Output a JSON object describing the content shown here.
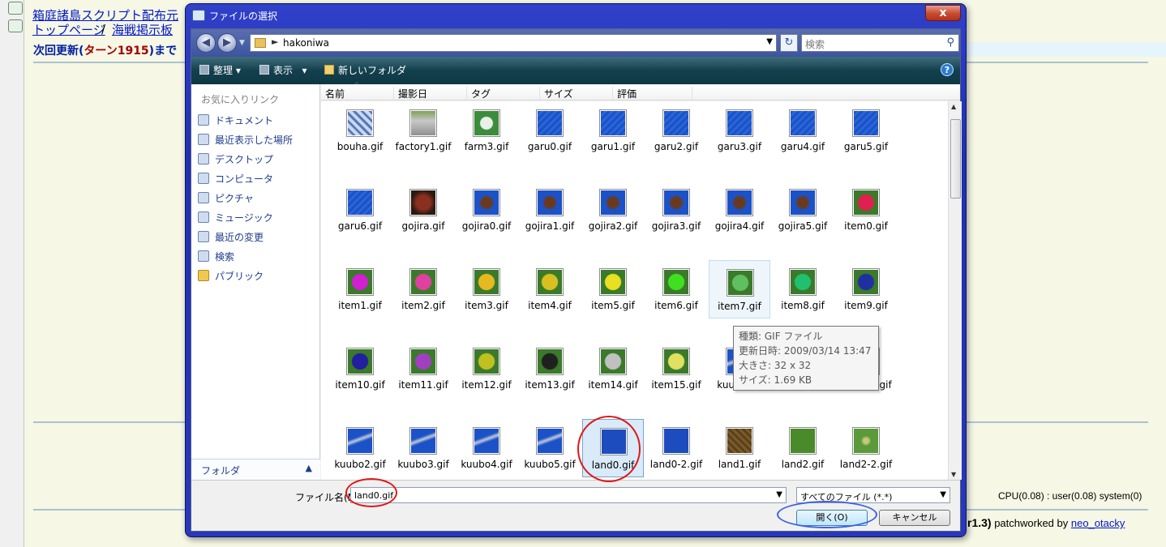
{
  "background": {
    "link1": "箱庭諸島スクリプト配布元",
    "link2": "トップページ",
    "link3": "海戦掲示板",
    "sep": "/",
    "notice": "次回更新(",
    "notice_turn": "ターン1915",
    "notice_tail": ")まで",
    "cpu": "CPU(0.08) : user(0.08) system(0)",
    "version": "r1.3)",
    "patch": " patchworked by ",
    "author": "neo_otacky"
  },
  "dialog": {
    "title": "ファイルの選択",
    "close": "x",
    "address": "hakoniwa",
    "search_placeholder": "検索",
    "toolbar": {
      "organize": "整理",
      "view": "表示",
      "new_folder": "新しいフォルダ",
      "help": "?"
    },
    "nav": {
      "favorites_title": "お気に入りリンク",
      "items": [
        "ドキュメント",
        "最近表示した場所",
        "デスクトップ",
        "コンピュータ",
        "ピクチャ",
        "ミュージック",
        "最近の変更",
        "検索",
        "パブリック"
      ],
      "folders": "フォルダ"
    },
    "columns": [
      "名前",
      "撮影日",
      "タグ",
      "サイズ",
      "評価"
    ],
    "files": [
      "bouha.gif",
      "factory1.gif",
      "farm3.gif",
      "garu0.gif",
      "garu1.gif",
      "garu2.gif",
      "garu3.gif",
      "garu4.gif",
      "garu5.gif",
      "garu6.gif",
      "gojira.gif",
      "gojira0.gif",
      "gojira1.gif",
      "gojira2.gif",
      "gojira3.gif",
      "gojira4.gif",
      "gojira5.gif",
      "item0.gif",
      "item1.gif",
      "item2.gif",
      "item3.gif",
      "item4.gif",
      "item5.gif",
      "item6.gif",
      "item7.gif",
      "item8.gif",
      "item9.gif",
      "item10.gif",
      "item11.gif",
      "item12.gif",
      "item13.gif",
      "item14.gif",
      "item15.gif",
      "kuubo.gif",
      "kuubo0.gif",
      "kuubo1.gif",
      "kuubo2.gif",
      "kuubo3.gif",
      "kuubo4.gif",
      "kuubo5.gif",
      "land0.gif",
      "land0-2.gif",
      "land1.gif",
      "land2.gif",
      "land2-2.gif"
    ],
    "tooltip": {
      "type": "種類: GIF ファイル",
      "modified": "更新日時: 2009/03/14 13:47",
      "dimensions": "大きさ: 32 x 32",
      "size": "サイズ: 1.69 KB"
    },
    "filename_label": "ファイル名(N):",
    "filename_value": "land0.gif",
    "filetype": "すべてのファイル (*.*)",
    "open_button": "開く(O)",
    "cancel_button": "キャンセル"
  }
}
